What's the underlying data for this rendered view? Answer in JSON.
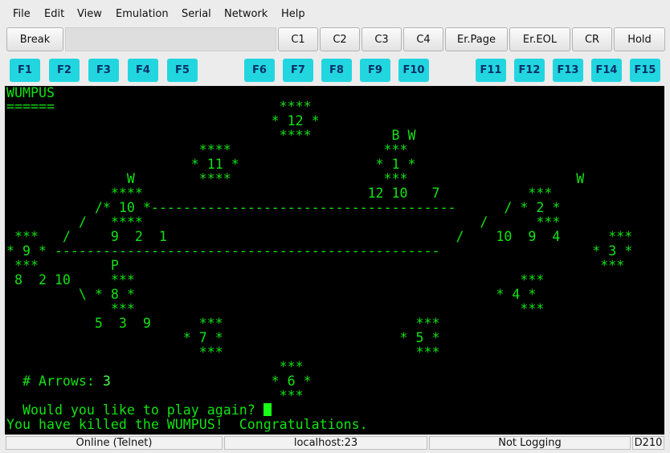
{
  "menu": [
    "File",
    "Edit",
    "View",
    "Emulation",
    "Serial",
    "Network",
    "Help"
  ],
  "toolbar": {
    "break": "Break",
    "c1": "C1",
    "c2": "C2",
    "c3": "C3",
    "c4": "C4",
    "er_page": "Er.Page",
    "er_eol": "Er.EOL",
    "cr": "CR",
    "hold": "Hold"
  },
  "fkeys": [
    "F1",
    "F2",
    "F3",
    "F4",
    "F5",
    "F6",
    "F7",
    "F8",
    "F9",
    "F10",
    "F11",
    "F12",
    "F13",
    "F14",
    "F15"
  ],
  "terminal": {
    "title": "WUMPUS",
    "underline": "======",
    "lines": [
      "                                  ****",
      "                                 * 12 *",
      "                                  ****          B W",
      "                        ****                   ***",
      "                       * 11 *                 * 1 *",
      "               W        ****                   ***                     W",
      "             ****                            12 10   7           ***",
      "           /* 10 *--------------------------------------      / * 2 *",
      "         /   ****                                          /      ***",
      " ***   /     9  2  1                                    /    10  9  4      ***",
      "* 9 * ------------------------------------------------                   * 3 *",
      " ***         P                                                            ***",
      " 8  2 10     ***                                                ***",
      "         \\ * 8 *                                             * 4 *",
      "             ***                                                ***",
      "           5  3  9      ***                        ***",
      "                      * 7 *                      * 5 *",
      "                        ***                        ***",
      "                                  ***",
      "  # Arrows: ",
      "                                  ***",
      "  Would you like to play again? ",
      "You have killed the WUMPUS!  Congratulations."
    ],
    "arrows_count": "3",
    "six_line_prefix": "                                 * 6 *",
    "colors": {
      "background": "#000000",
      "text": "#12e212",
      "cursor": "#19ff19"
    }
  },
  "status": {
    "connection": "Online (Telnet)",
    "host": "localhost:23",
    "logging": "Not Logging",
    "model": "D210"
  },
  "colors": {
    "fkey_bg": "#22d6e0",
    "fkey_text": "#06306a",
    "chrome": "#ececec"
  }
}
